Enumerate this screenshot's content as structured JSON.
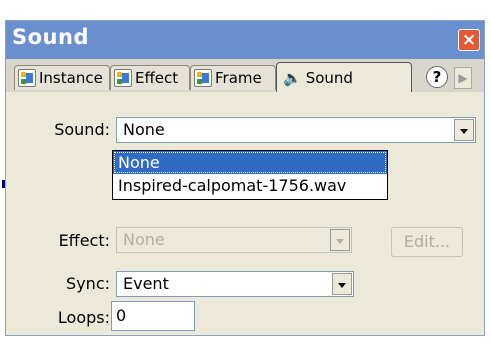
{
  "window": {
    "title": "Sound",
    "close_symbol": "×"
  },
  "tabs": [
    {
      "label": "Instance",
      "active": false
    },
    {
      "label": "Effect",
      "active": false
    },
    {
      "label": "Frame",
      "active": false
    },
    {
      "label": "Sound",
      "active": true
    }
  ],
  "help_symbol": "?",
  "scroll_symbol": "▶",
  "sound": {
    "label": "Sound:",
    "value": "None",
    "options": [
      "None",
      "Inspired-calpomat-1756.wav"
    ],
    "highlighted_option": "None"
  },
  "effect": {
    "label": "Effect:",
    "value": "None",
    "enabled": false,
    "edit_label": "Edit..."
  },
  "sync": {
    "label": "Sync:",
    "value": "Event"
  },
  "loops": {
    "label": "Loops:",
    "value": "0"
  },
  "colors": {
    "title_bar": "#6a8fcf",
    "panel": "#ece9d8",
    "selection": "#316ac5",
    "close": "#e35a34"
  }
}
